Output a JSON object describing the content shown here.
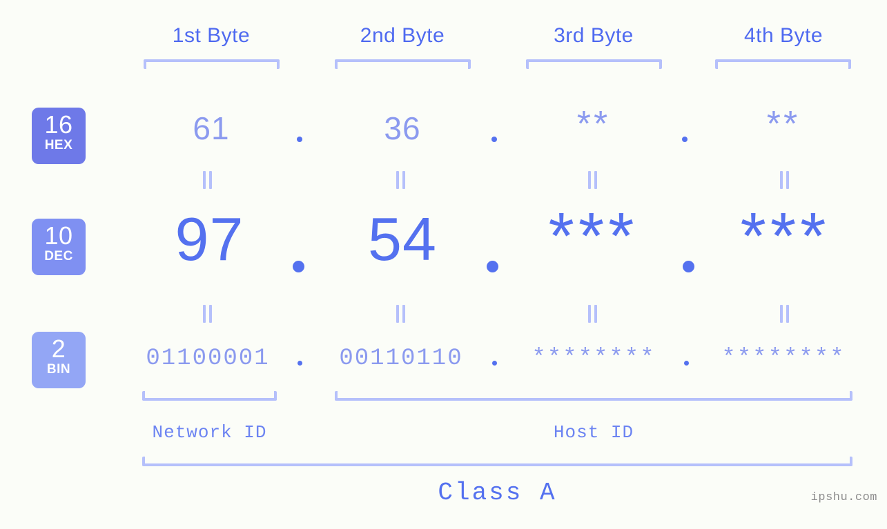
{
  "background_color": "#fbfdf8",
  "accent_colors": {
    "strong": "#5471ef",
    "medium": "#8b9aef",
    "light": "#b5c0fb",
    "badge_hex": "#6e79e8",
    "badge_dec": "#7f90f2",
    "badge_bin": "#93a6f5"
  },
  "byte_headers": [
    {
      "label": "1st Byte"
    },
    {
      "label": "2nd Byte"
    },
    {
      "label": "3rd Byte"
    },
    {
      "label": "4th Byte"
    }
  ],
  "rows": [
    {
      "badge_number": "16",
      "badge_name": "HEX",
      "values": [
        "61",
        "36",
        "**",
        "**"
      ]
    },
    {
      "badge_number": "10",
      "badge_name": "DEC",
      "values": [
        "97",
        "54",
        "***",
        "***"
      ]
    },
    {
      "badge_number": "2",
      "badge_name": "BIN",
      "values": [
        "01100001",
        "00110110",
        "********",
        "********"
      ]
    }
  ],
  "separators": {
    "dot": ".",
    "equals": "="
  },
  "segments": {
    "network_id": "Network ID",
    "host_id": "Host ID",
    "class": "Class A"
  },
  "watermark": "ipshu.com"
}
